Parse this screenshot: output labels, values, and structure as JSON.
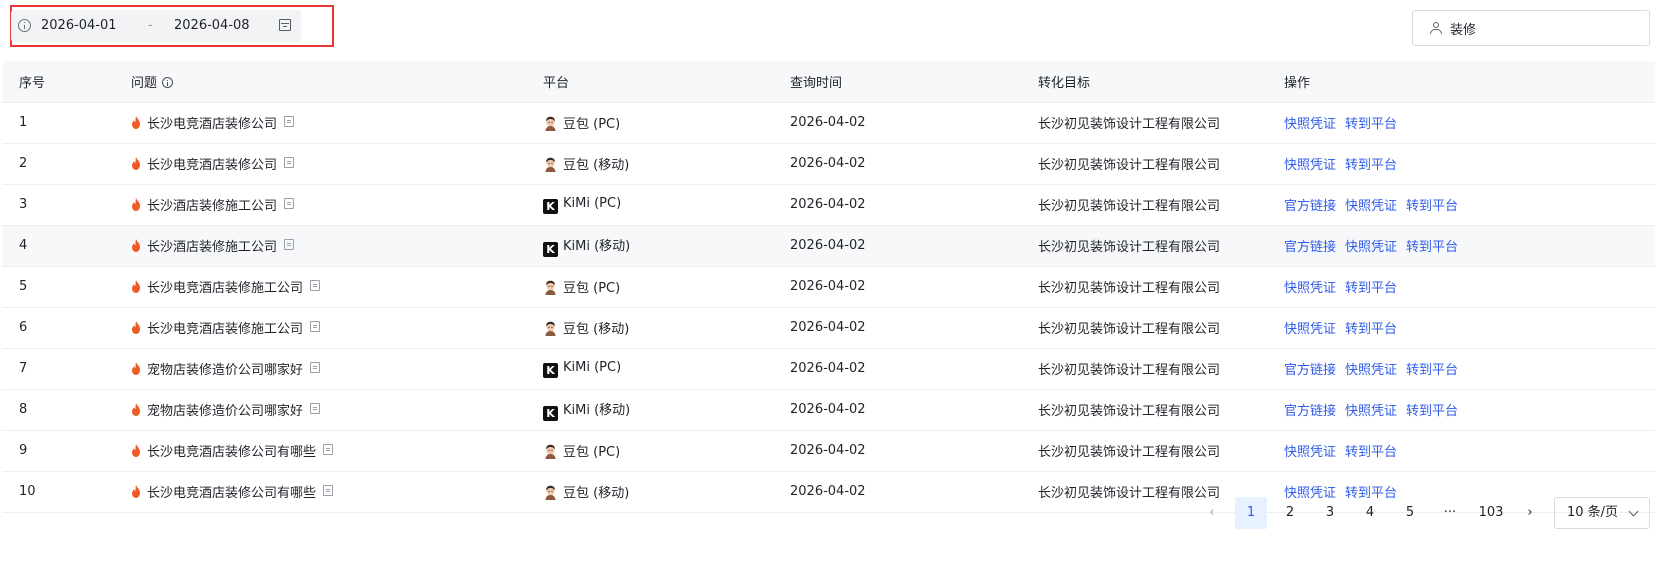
{
  "filters": {
    "date_start": "2026-04-01",
    "date_sep": "-",
    "date_end": "2026-04-08",
    "keyword": "装修"
  },
  "table": {
    "headers": {
      "index": "序号",
      "question": "问题",
      "platform": "平台",
      "query_time": "查询时间",
      "target": "转化目标",
      "actions": "操作"
    },
    "rows": [
      {
        "index": "1",
        "question": "长沙电竞酒店装修公司",
        "platform_logo": "doubao-logo",
        "platform": "豆包 (PC)",
        "query_time": "2026-04-02",
        "target": "长沙初见装饰设计工程有限公司",
        "actions": [
          "快照凭证",
          "转到平台"
        ]
      },
      {
        "index": "2",
        "question": "长沙电竞酒店装修公司",
        "platform_logo": "doubao-logo",
        "platform": "豆包 (移动)",
        "query_time": "2026-04-02",
        "target": "长沙初见装饰设计工程有限公司",
        "actions": [
          "快照凭证",
          "转到平台"
        ]
      },
      {
        "index": "3",
        "question": "长沙酒店装修施工公司",
        "platform_logo": "kimi-logo",
        "platform": "KiMi (PC)",
        "query_time": "2026-04-02",
        "target": "长沙初见装饰设计工程有限公司",
        "actions": [
          "官方链接",
          "快照凭证",
          "转到平台"
        ]
      },
      {
        "index": "4",
        "question": "长沙酒店装修施工公司",
        "platform_logo": "kimi-logo",
        "platform": "KiMi (移动)",
        "query_time": "2026-04-02",
        "target": "长沙初见装饰设计工程有限公司",
        "actions": [
          "官方链接",
          "快照凭证",
          "转到平台"
        ]
      },
      {
        "index": "5",
        "question": "长沙电竞酒店装修施工公司",
        "platform_logo": "doubao-logo",
        "platform": "豆包 (PC)",
        "query_time": "2026-04-02",
        "target": "长沙初见装饰设计工程有限公司",
        "actions": [
          "快照凭证",
          "转到平台"
        ]
      },
      {
        "index": "6",
        "question": "长沙电竞酒店装修施工公司",
        "platform_logo": "doubao-logo",
        "platform": "豆包 (移动)",
        "query_time": "2026-04-02",
        "target": "长沙初见装饰设计工程有限公司",
        "actions": [
          "快照凭证",
          "转到平台"
        ]
      },
      {
        "index": "7",
        "question": "宠物店装修造价公司哪家好",
        "platform_logo": "kimi-logo",
        "platform": "KiMi (PC)",
        "query_time": "2026-04-02",
        "target": "长沙初见装饰设计工程有限公司",
        "actions": [
          "官方链接",
          "快照凭证",
          "转到平台"
        ]
      },
      {
        "index": "8",
        "question": "宠物店装修造价公司哪家好",
        "platform_logo": "kimi-logo",
        "platform": "KiMi (移动)",
        "query_time": "2026-04-02",
        "target": "长沙初见装饰设计工程有限公司",
        "actions": [
          "官方链接",
          "快照凭证",
          "转到平台"
        ]
      },
      {
        "index": "9",
        "question": "长沙电竞酒店装修公司有哪些",
        "platform_logo": "doubao-logo",
        "platform": "豆包 (PC)",
        "query_time": "2026-04-02",
        "target": "长沙初见装饰设计工程有限公司",
        "actions": [
          "快照凭证",
          "转到平台"
        ]
      },
      {
        "index": "10",
        "question": "长沙电竞酒店装修公司有哪些",
        "platform_logo": "doubao-logo",
        "platform": "豆包 (移动)",
        "query_time": "2026-04-02",
        "target": "长沙初见装饰设计工程有限公司",
        "actions": [
          "快照凭证",
          "转到平台"
        ]
      }
    ]
  },
  "pagination": {
    "prev": "‹",
    "pages": [
      "1",
      "2",
      "3",
      "4",
      "5"
    ],
    "ellipsis": "···",
    "last": "103",
    "next": "›",
    "current": "1",
    "page_size": "10 条/页"
  },
  "colors": {
    "accent": "#2f5bea",
    "highlight_border": "#e8393a",
    "fire": "#f05a24"
  }
}
